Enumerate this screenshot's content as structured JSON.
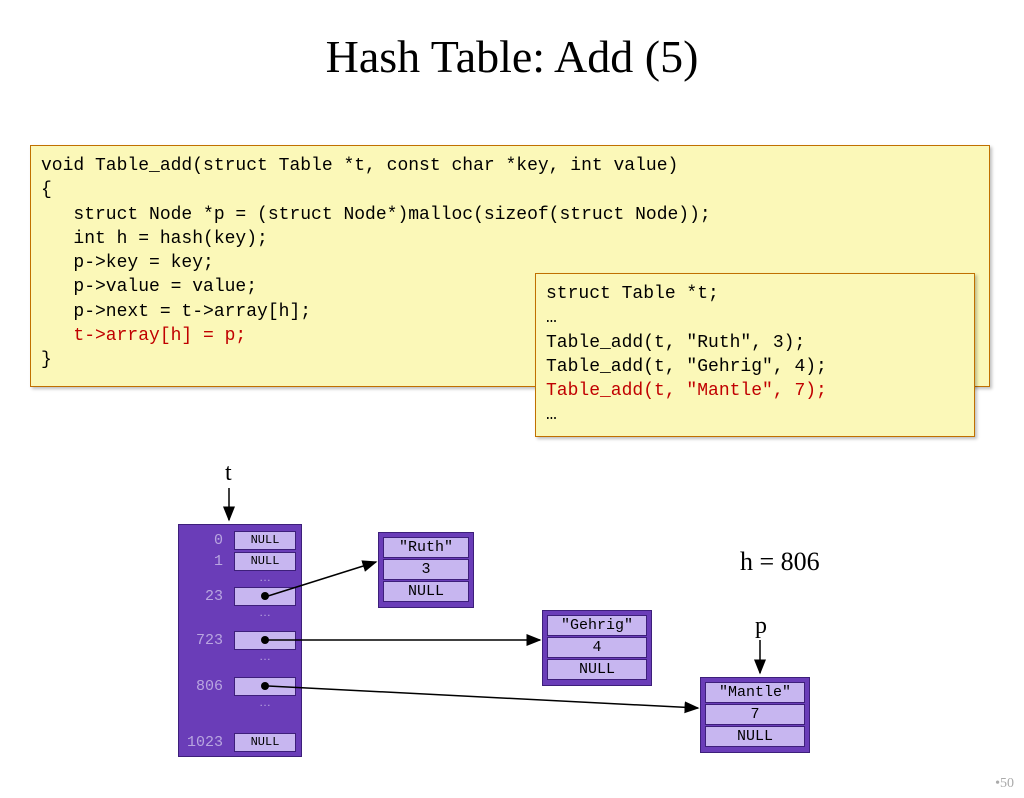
{
  "title": "Hash Table: Add (5)",
  "code1": {
    "l1": "void Table_add(struct Table *t, const char *key, int value)",
    "l2": "{",
    "l3": "   struct Node *p = (struct Node*)malloc(sizeof(struct Node));",
    "l4": "   int h = hash(key);",
    "l5": "   p->key = key;",
    "l6": "   p->value = value;",
    "l7": "   p->next = t->array[h];",
    "l8": "   t->array[h] = p;",
    "l9": "}"
  },
  "code2": {
    "l1": "struct Table *t;",
    "l2": "…",
    "l3": "Table_add(t, \"Ruth\", 3);",
    "l4": "Table_add(t, \"Gehrig\", 4);",
    "l5": "Table_add(t, \"Mantle\", 7);",
    "l6": "…"
  },
  "labels": {
    "t": "t",
    "h": "h = 806",
    "p": "p"
  },
  "hashtable": {
    "idx0": "0",
    "cell0": "NULL",
    "idx1": "1",
    "cell1": "NULL",
    "ell1": "…",
    "idx23": "23",
    "ell2": "…",
    "idx723": "723",
    "ell3": "…",
    "idx806": "806",
    "ell4": "…",
    "idx1023": "1023",
    "cell1023": "NULL"
  },
  "nodes": {
    "ruth": {
      "key": "\"Ruth\"",
      "val": "3",
      "next": "NULL"
    },
    "gehrig": {
      "key": "\"Gehrig\"",
      "val": "4",
      "next": "NULL"
    },
    "mantle": {
      "key": "\"Mantle\"",
      "val": "7",
      "next": "NULL"
    }
  },
  "slide_num": "•50"
}
